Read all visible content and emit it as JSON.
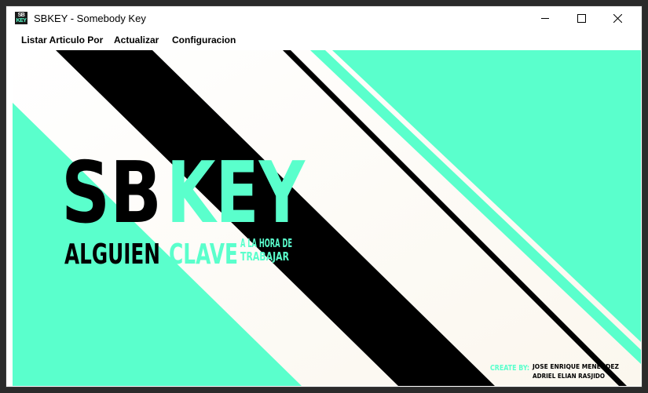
{
  "window": {
    "title": "SBKEY - Somebody Key",
    "icon": {
      "name": "sbkey-app-icon",
      "line1": "SB",
      "line2": "KEY"
    },
    "controls": {
      "minimize": "minimize-icon",
      "maximize": "maximize-icon",
      "close": "close-icon"
    }
  },
  "menu": {
    "items": [
      {
        "label": "Listar Articulo Por"
      },
      {
        "label": "Actualizar"
      },
      {
        "label": "Configuracion"
      }
    ]
  },
  "splash": {
    "logo_sb": "SB",
    "logo_key": "KEY",
    "tagline_alguien": "ALGUIEN",
    "tagline_clave": "CLAVE",
    "tagline_small_1": "A LA HORA DE",
    "tagline_small_2": "TRABAJAR",
    "credits_label": "CREATE BY:",
    "credits_name_1": "JOSE ENRIQUE MENENDEZ",
    "credits_name_2": "ADRIEL ELIAN RASJIDO"
  },
  "colors": {
    "accent": "#5affcc",
    "dark": "#000000",
    "light": "#ffffff"
  }
}
